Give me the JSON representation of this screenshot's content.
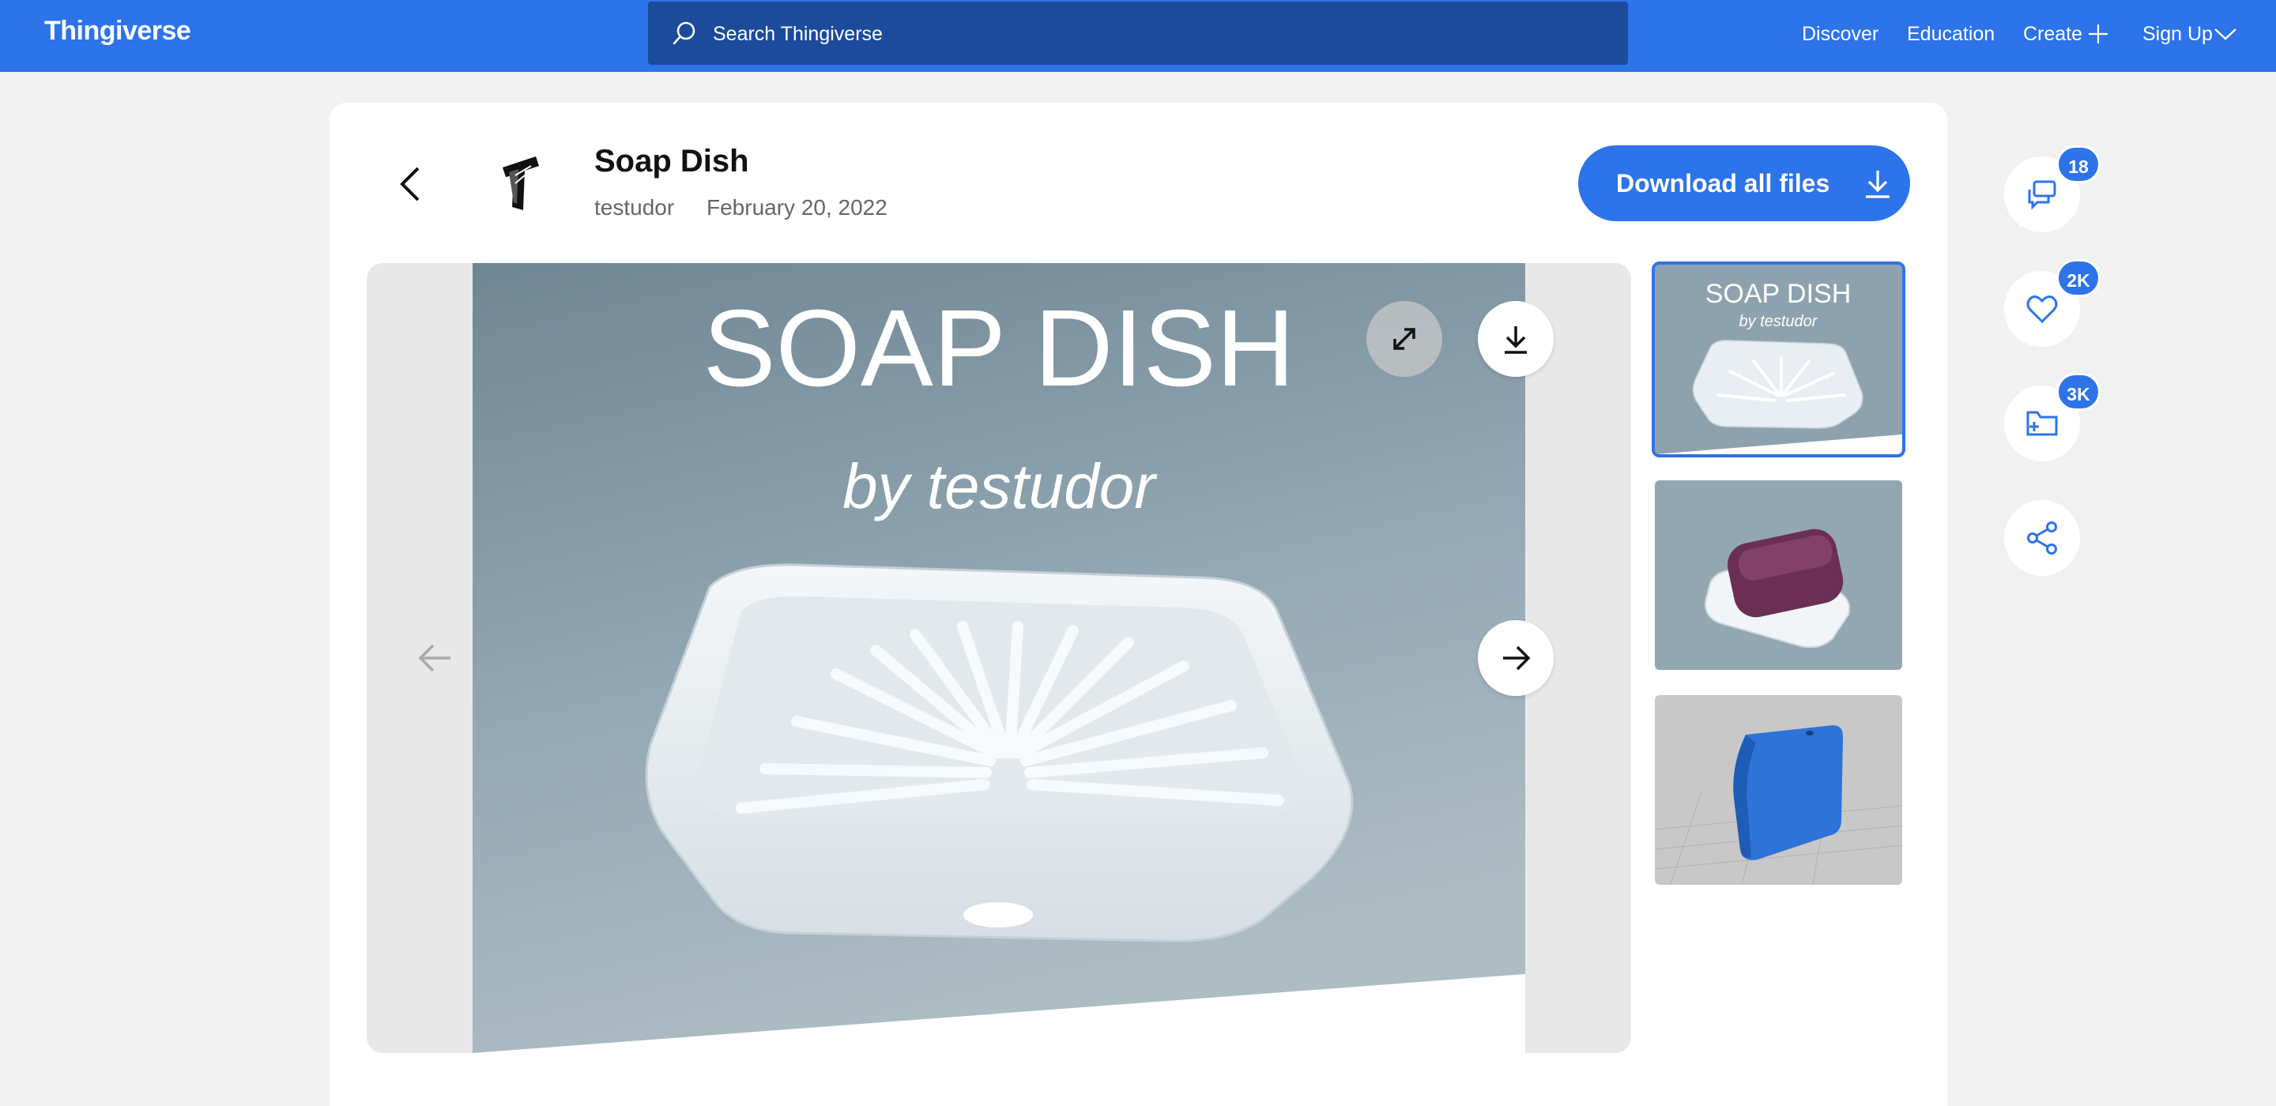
{
  "app": {
    "logo": "Thingiverse"
  },
  "header": {
    "search_placeholder": "Search Thingiverse",
    "nav": {
      "discover": "Discover",
      "education": "Education",
      "create": "Create",
      "signup": "Sign Up"
    }
  },
  "thing": {
    "title": "Soap Dish",
    "author": "testudor",
    "date": "February 20, 2022",
    "download_label": "Download all files"
  },
  "image": {
    "heading": "SOAP DISH",
    "byline": "by testudor"
  },
  "stats": {
    "comments": "18",
    "likes": "2K",
    "collections": "3K"
  },
  "colors": {
    "brand": "#2d73ea",
    "search_bg": "#1c4b9c",
    "page_bg": "#f1f1f1"
  },
  "icons": [
    "search-icon",
    "plus-icon",
    "chevron-down-icon",
    "chevron-left-icon",
    "download-icon",
    "expand-icon",
    "arrow-left-icon",
    "arrow-right-icon",
    "comments-icon",
    "heart-icon",
    "folder-plus-icon",
    "share-icon"
  ]
}
